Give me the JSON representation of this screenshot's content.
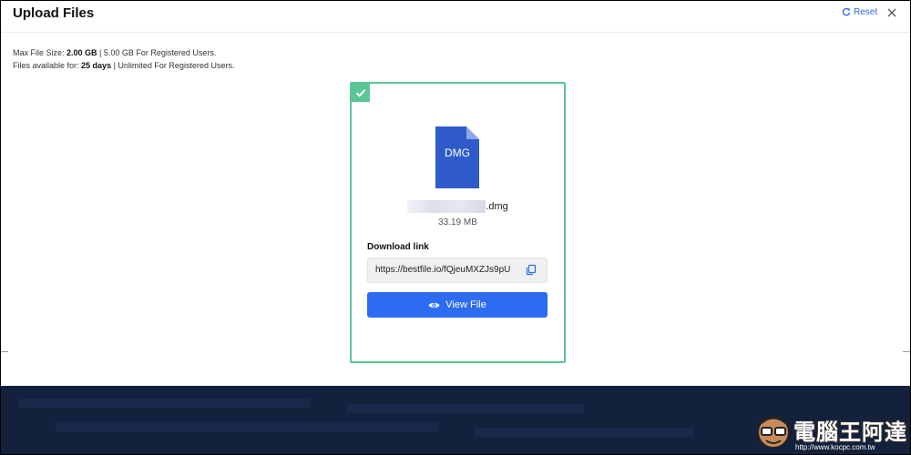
{
  "header": {
    "title": "Upload Files",
    "reset_label": "Reset"
  },
  "info": {
    "max_size_prefix": "Max File Size: ",
    "max_size_value": "2.00 GB",
    "max_size_suffix": " | 5.00 GB For Registered Users.",
    "avail_prefix": "Files available for: ",
    "avail_value": "25 days",
    "avail_suffix": " | Unlimited For Registered Users."
  },
  "file": {
    "type_label": "DMG",
    "name_suffix": ".dmg",
    "size": "33.19 MB"
  },
  "download": {
    "label": "Download link",
    "url": "https://bestfile.io/fQjeuMXZJs9pU"
  },
  "actions": {
    "view_label": "View File"
  },
  "watermark": {
    "text": "電腦王阿達",
    "url": "http://www.kocpc.com.tw"
  },
  "colors": {
    "accent": "#2d6cf0",
    "success": "#5cc694",
    "band": "#14213d"
  }
}
